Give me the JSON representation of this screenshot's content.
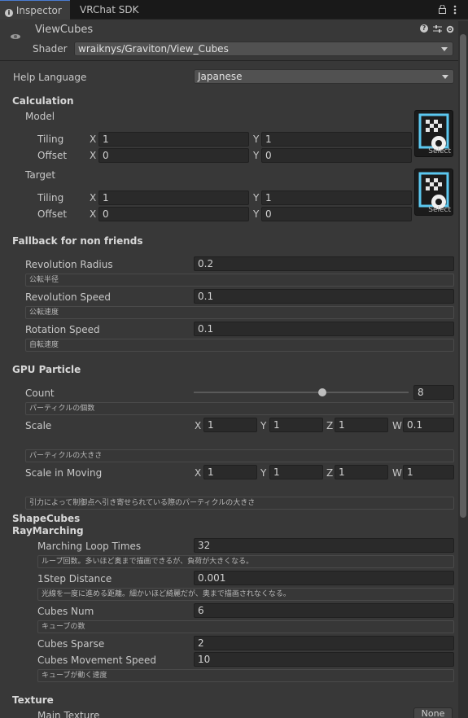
{
  "tabs": {
    "inspector": "Inspector",
    "sdk": "VRChat SDK"
  },
  "header": {
    "title": "ViewCubes",
    "shader_label": "Shader",
    "shader_value": "wraiknys/Graviton/View_Cubes"
  },
  "help_language": {
    "label": "Help Language",
    "value": "Japanese"
  },
  "calculation": {
    "title": "Calculation",
    "model": {
      "title": "Model",
      "tiling_label": "Tiling",
      "offset_label": "Offset",
      "tiling_x": "1",
      "tiling_y": "1",
      "offset_x": "0",
      "offset_y": "0"
    },
    "target": {
      "title": "Target",
      "tiling_label": "Tiling",
      "offset_label": "Offset",
      "tiling_x": "1",
      "tiling_y": "1",
      "offset_x": "0",
      "offset_y": "0"
    },
    "x_label": "X",
    "y_label": "Y",
    "select_label": "Select"
  },
  "fallback": {
    "title": "Fallback for non friends",
    "radius_label": "Revolution Radius",
    "radius_value": "0.2",
    "radius_help": "公転半径",
    "speed_label": "Revolution Speed",
    "speed_value": "0.1",
    "speed_help": "公転速度",
    "rotation_label": "Rotation Speed",
    "rotation_value": "0.1",
    "rotation_help": "自転速度"
  },
  "gpu": {
    "title": "GPU Particle",
    "count_label": "Count",
    "count_value": "8",
    "count_fraction": 0.6,
    "count_help": "パーティクルの個数",
    "scale_label": "Scale",
    "scale_x": "1",
    "scale_y": "1",
    "scale_z": "1",
    "scale_w": "0.1",
    "scale_help": "パーティクルの大きさ",
    "moving_label": "Scale in Moving",
    "moving_x": "1",
    "moving_y": "1",
    "moving_z": "1",
    "moving_w": "1",
    "moving_help": "引力によって制御点へ引き寄せられている際のパーティクルの大きさ",
    "x": "X",
    "y": "Y",
    "z": "Z",
    "w": "W"
  },
  "shape": {
    "title1": "ShapeCubes",
    "title2": "RayMarching",
    "loop_label": "Marching Loop Times",
    "loop_value": "32",
    "loop_help": "ループ回数。多いほど奥まで描画できるが、負荷が大きくなる。",
    "step_label": "1Step Distance",
    "step_value": "0.001",
    "step_help": "光線を一度に進める距離。細かいほど綺麗だが、奥まで描画されなくなる。",
    "num_label": "Cubes Num",
    "num_value": "6",
    "num_help": "キューブの数",
    "sparse_label": "Cubes Sparse",
    "sparse_value": "2",
    "move_label": "Cubes Movement Speed",
    "move_value": "10",
    "move_help": "キューブが動く速度"
  },
  "texture": {
    "title": "Texture",
    "main_label": "Main Texture",
    "main_value": "None"
  },
  "colors": {
    "background": "#383838",
    "field": "#2a2a2a",
    "accent": "#4a7bd1",
    "texture_frame": "#5bc8f0"
  }
}
